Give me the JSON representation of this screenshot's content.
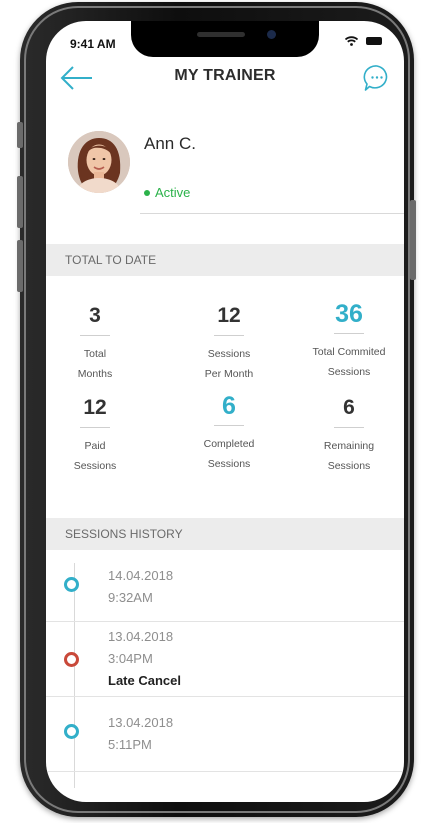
{
  "status_bar": {
    "time": "9:41 AM"
  },
  "nav": {
    "title": "MY TRAINER"
  },
  "profile": {
    "name": "Ann C.",
    "status": "Active"
  },
  "totals": {
    "header": "TOTAL TO DATE",
    "stats": [
      {
        "value": "3",
        "label_line1": "Total",
        "label_line2": "Months"
      },
      {
        "value": "12",
        "label_line1": "Sessions",
        "label_line2": "Per Month"
      },
      {
        "value": "36",
        "label_line1": "Total Commited",
        "label_line2": "Sessions"
      },
      {
        "value": "12",
        "label_line1": "Paid",
        "label_line2": "Sessions"
      },
      {
        "value": "6",
        "label_line1": "Completed",
        "label_line2": "Sessions"
      },
      {
        "value": "6",
        "label_line1": "Remaining",
        "label_line2": "Sessions"
      }
    ]
  },
  "history": {
    "header": "SESSIONS HISTORY",
    "sessions": [
      {
        "date": "14.04.2018",
        "time": "9:32AM",
        "note": "",
        "status_color": "#32afc9"
      },
      {
        "date": "13.04.2018",
        "time": "3:04PM",
        "note": "Late Cancel",
        "status_color": "#c9493a"
      },
      {
        "date": "13.04.2018",
        "time": "5:11PM",
        "note": "",
        "status_color": "#32afc9"
      }
    ]
  },
  "colors": {
    "accent": "#32afc9",
    "active": "#2bb24a",
    "cancel": "#c9493a"
  }
}
